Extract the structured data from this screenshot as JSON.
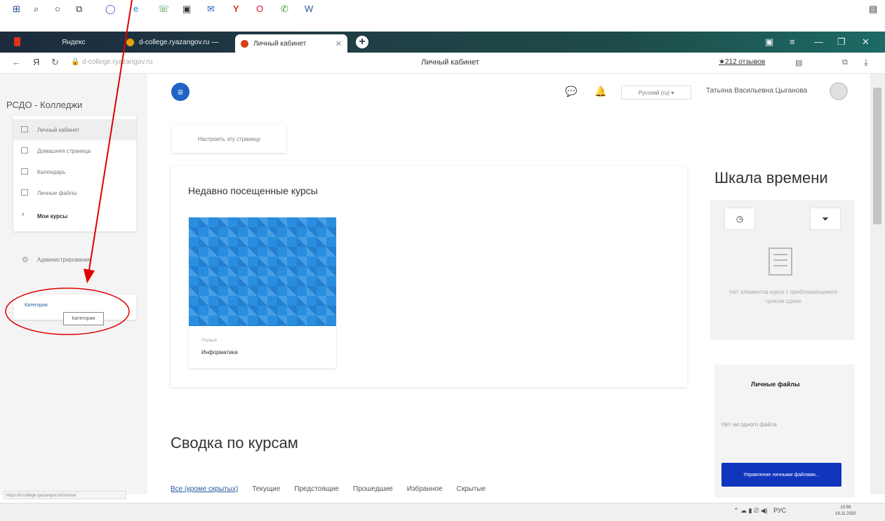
{
  "browser": {
    "tabs": [
      {
        "label": "Яндекс"
      },
      {
        "label": "d-college.ryazangov.ru —"
      },
      {
        "label": "Личный кабинет"
      }
    ],
    "url": "d-college.ryazangov.ru",
    "page_title": "Личный кабинет",
    "reviews_label": "★212 отзывов",
    "status_url": "https://d-college.ryazangov.ru/course/"
  },
  "header": {
    "lang": "Русский (ru) ▾",
    "user_name": "Татьяна Васильевна Цыганова"
  },
  "sidebar": {
    "brand": "РСДО - Колледжи",
    "items": [
      {
        "label": "Личный кабинет"
      },
      {
        "label": "Домашняя страница"
      },
      {
        "label": "Календарь"
      },
      {
        "label": "Личные файлы"
      },
      {
        "label": "Мои курсы"
      }
    ],
    "admin_label": "Администрирование",
    "categories_link": "Категории",
    "tooltip": "Категории"
  },
  "main": {
    "customize_label": "Настроить эту страницу",
    "recent_title": "Недавно посещенные курсы",
    "course": {
      "category": "Первый",
      "name": "Информатика"
    },
    "summary_title": "Сводка по курсам",
    "filters": [
      "Все (кроме скрытых)",
      "Текущие",
      "Предстоящие",
      "Прошедшие",
      "Избранное",
      "Скрытые"
    ]
  },
  "timeline": {
    "title": "Шкала времени",
    "empty_text": "Нет элементов курса с приближающимся сроком сдачи"
  },
  "files": {
    "title": "Личные файлы",
    "empty_text": "Нет ни одного файла",
    "manage_button": "Управление личными файлами..."
  },
  "taskbar": {
    "tray_lang": "РУС",
    "time": "10:59",
    "date": "19.11.2020"
  },
  "colors": {
    "accent": "#1f63c4",
    "files_button": "#1136bd",
    "annotation": "#e00000"
  }
}
